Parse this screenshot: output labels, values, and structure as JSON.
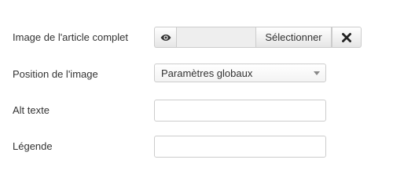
{
  "fields": {
    "full_image": {
      "label": "Image de l'article complet",
      "path_value": "",
      "select_label": "Sélectionner",
      "preview_icon": "eye-icon",
      "clear_icon": "close-icon"
    },
    "image_position": {
      "label": "Position de l'image",
      "selected": "Paramètres globaux",
      "caret_icon": "caret-down-icon"
    },
    "alt_text": {
      "label": "Alt texte",
      "value": ""
    },
    "caption": {
      "label": "Légende",
      "value": ""
    }
  }
}
